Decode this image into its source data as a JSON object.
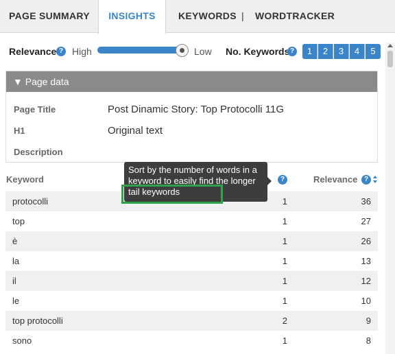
{
  "tabs": [
    {
      "label": "PAGE SUMMARY"
    },
    {
      "label": "INSIGHTS",
      "active": true
    },
    {
      "label": "KEYWORDS"
    },
    {
      "label": "WORDTRACKER"
    }
  ],
  "tab_separator": "|",
  "controls": {
    "relevance_label": "Relevance",
    "high_label": "High",
    "low_label": "Low",
    "slider_level": "High to Low (thumb at Low end)",
    "num_keywords_label": "No. Keywords",
    "num_buttons": [
      "1",
      "2",
      "3",
      "4",
      "5"
    ],
    "help_glyph": "?"
  },
  "page_data": {
    "header": "▼ Page data",
    "fields": [
      {
        "key": "Page Title",
        "value": "Post Dinamic Story: Top Protocolli 11G"
      },
      {
        "key": "H1",
        "value": "Original text"
      },
      {
        "key": "Description",
        "value": ""
      }
    ]
  },
  "table": {
    "headers": {
      "keyword": "Keyword",
      "relevance": "Relevance"
    },
    "rows": [
      {
        "keyword": "protocolli",
        "words": "1",
        "relevance": "36"
      },
      {
        "keyword": "top",
        "words": "1",
        "relevance": "27"
      },
      {
        "keyword": "è",
        "words": "1",
        "relevance": "26"
      },
      {
        "keyword": "la",
        "words": "1",
        "relevance": "13"
      },
      {
        "keyword": "il",
        "words": "1",
        "relevance": "12"
      },
      {
        "keyword": "le",
        "words": "1",
        "relevance": "10"
      },
      {
        "keyword": "top protocolli",
        "words": "2",
        "relevance": "9"
      },
      {
        "keyword": "sono",
        "words": "1",
        "relevance": "8"
      }
    ]
  },
  "tooltip": {
    "text": "Sort by the number of words in a keyword to easily find the longer tail keywords"
  },
  "colors": {
    "accent": "#3a84c9",
    "highlight": "#2ea34a",
    "panel_header": "#8a8a8a",
    "tooltip_bg": "#3d3d3d"
  }
}
